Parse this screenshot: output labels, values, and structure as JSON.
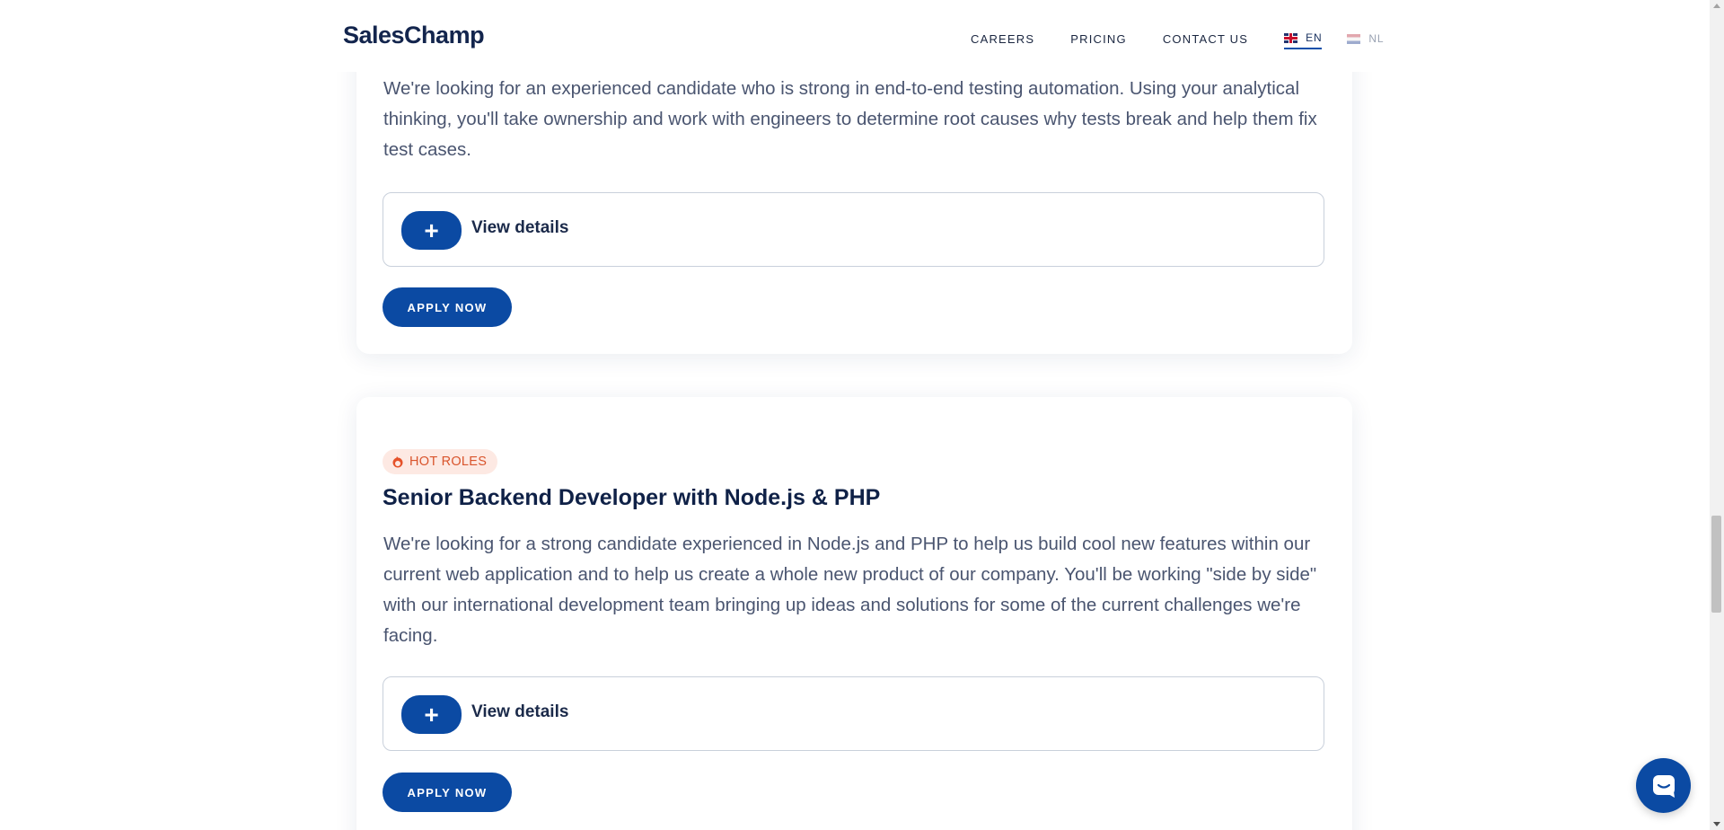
{
  "header": {
    "logo": "SalesChamp",
    "nav": {
      "careers": "CAREERS",
      "pricing": "PRICING",
      "contact": "CONTACT US"
    },
    "languages": [
      {
        "code": "EN",
        "active": true
      },
      {
        "code": "NL",
        "active": false
      }
    ]
  },
  "jobs": [
    {
      "description": "We're looking for an experienced candidate who is strong in end-to-end testing automation. Using your analytical thinking, you'll take ownership and work with engineers to determine root causes why tests break and help them fix test cases.",
      "details_label": "View details",
      "expand_symbol": "+",
      "apply_label": "APPLY NOW"
    },
    {
      "badge": "HOT ROLES",
      "title": "Senior Backend Developer with Node.js & PHP",
      "description": "We're looking for a strong candidate experienced in Node.js and PHP to help us build cool new features within our current web application and to help us create a whole new product of our company. You'll be working \"side by side\" with our international development team bringing up ideas and solutions for some of the current challenges we're facing.",
      "details_label": "View details",
      "expand_symbol": "+",
      "apply_label": "APPLY NOW"
    }
  ],
  "colors": {
    "primary": "#0b4aa3",
    "heading": "#0f2147",
    "body_text": "#4a5570",
    "badge_bg": "#fde9e3",
    "badge_text": "#d9542c"
  }
}
